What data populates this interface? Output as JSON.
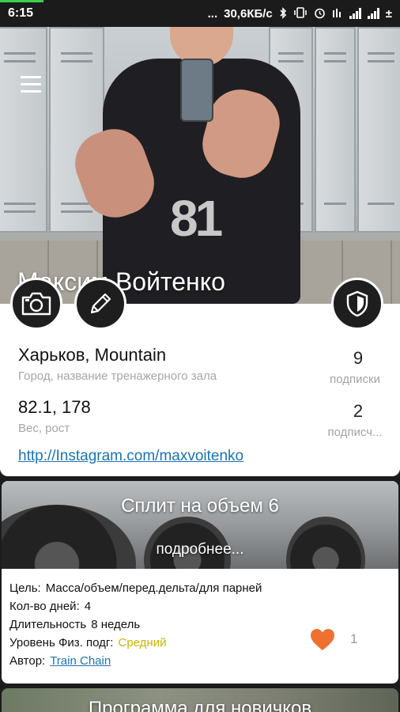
{
  "status_bar": {
    "time": "6:15",
    "dots": "...",
    "network_speed": "30,6КБ/с",
    "bluetooth_icon": "bluetooth-icon",
    "vibrate_icon": "vibrate-icon",
    "alarm_icon": "alarm-icon",
    "signal_icon": "signal-icon",
    "data_arrows": "±",
    "accent_color": "#3ccf4e"
  },
  "profile": {
    "name": "Максим Войтенко",
    "city_gym": "Харьков, Mountain",
    "city_gym_hint": "Город, название тренажерного зала",
    "weight_height": "82.1, 178",
    "weight_height_hint": "Вес, рост",
    "following_count": "9",
    "following_label": "подписки",
    "followers_count": "2",
    "followers_label": "подписч...",
    "instagram": "http://Instagram.com/maxvoitenko",
    "buttons": {
      "camera": "camera-icon",
      "edit": "pencil-icon",
      "privacy": "shield-icon",
      "menu": "hamburger-menu-icon"
    }
  },
  "program": {
    "title": "Сплит на объем 6",
    "more": "подробнее...",
    "goal_label": "Цель:",
    "goal_value": "Масса/объем/перед.дельта/для парней",
    "days_label": "Кол-во дней:",
    "days_value": "4",
    "duration_label": "Длительность",
    "duration_value": "8 недель",
    "level_label": "Уровень Физ. подг:",
    "level_value": "Средний",
    "author_label": "Автор:",
    "author_value": "Train Chain",
    "likes": "1",
    "heart_color": "#f07030",
    "level_color": "#c9b400"
  },
  "next_program": {
    "title": "Программа для новичков"
  }
}
